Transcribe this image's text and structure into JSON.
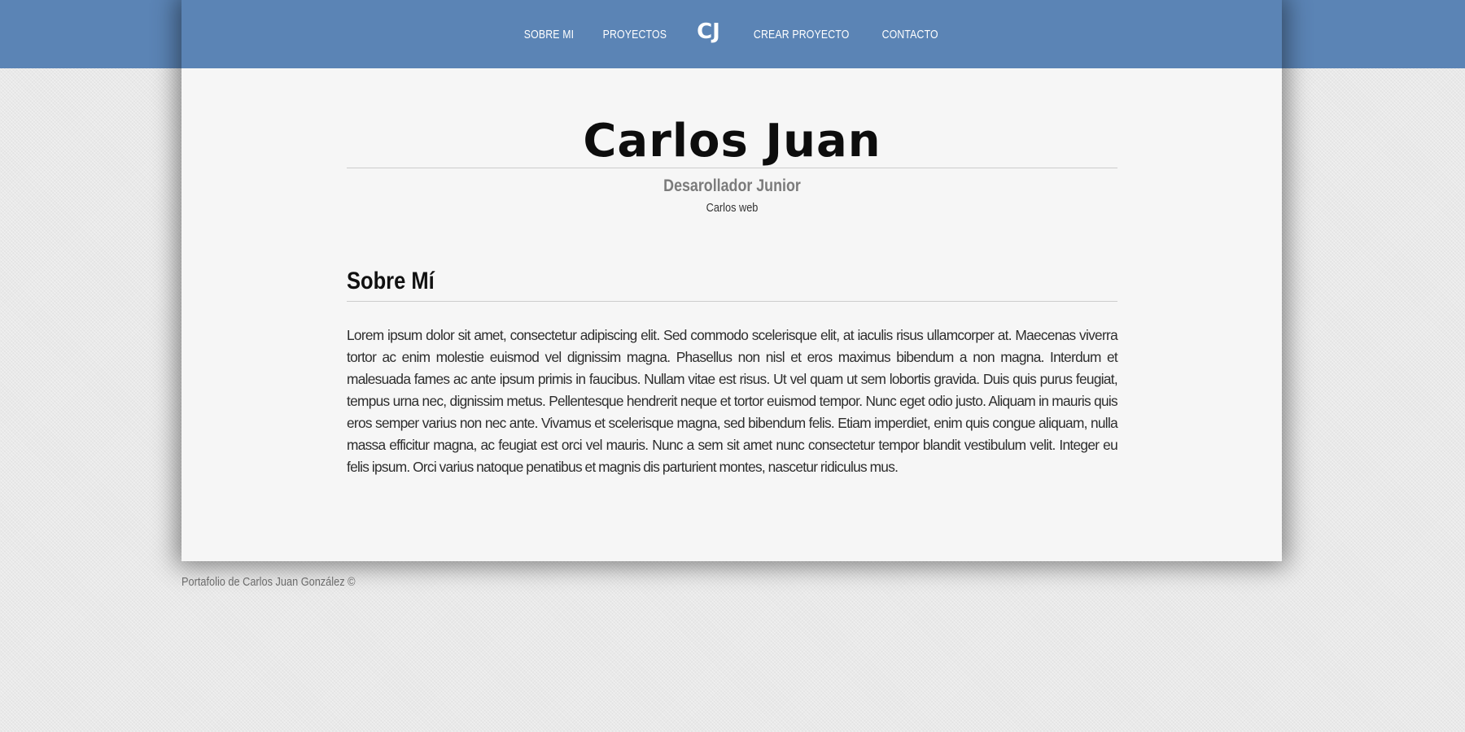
{
  "nav": {
    "items": [
      {
        "label": "SOBRE MI"
      },
      {
        "label": "PROYECTOS"
      },
      {
        "label": "CREAR PROYECTO"
      },
      {
        "label": "CONTACTO"
      }
    ],
    "logo_text": "CJ"
  },
  "header": {
    "name": "Carlos Juan",
    "role": "Desarollador Junior",
    "subtitle": "Carlos web"
  },
  "about": {
    "title": "Sobre Mí",
    "text": "Lorem ipsum dolor sit amet, consectetur adipiscing elit. Sed commodo scelerisque elit, at iaculis risus ullamcorper at. Maecenas viverra tortor ac enim molestie euismod vel dignissim magna. Phasellus non nisl et eros maximus bibendum a non magna. Interdum et malesuada fames ac ante ipsum primis in faucibus. Nullam vitae est risus. Ut vel quam ut sem lobortis gravida. Duis quis purus feugiat, tempus urna nec, dignissim metus. Pellentesque hendrerit neque et tortor euismod tempor. Nunc eget odio justo. Aliquam in mauris quis eros semper varius non nec ante. Vivamus et scelerisque magna, sed bibendum felis. Etiam imperdiet, enim quis congue aliquam, nulla massa efficitur magna, ac feugiat est orci vel mauris. Nunc a sem sit amet nunc consectetur tempor blandit vestibulum velit. Integer eu felis ipsum. Orci varius natoque penatibus et magnis dis parturient montes, nascetur ridiculus mus."
  },
  "footer": {
    "text": "Portafolio de Carlos Juan González ©"
  },
  "colors": {
    "nav_background": "#5b84b5",
    "card_background": "#f6f6f6",
    "page_background": "#e9e9e9"
  }
}
